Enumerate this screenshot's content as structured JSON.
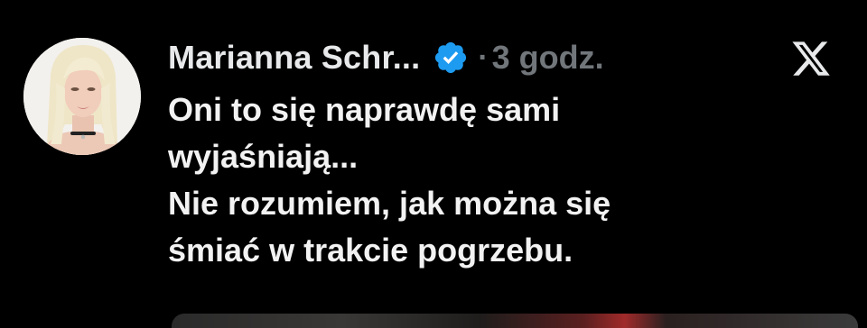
{
  "tweet": {
    "author_name": "Marianna Schr...",
    "separator": "·",
    "time": "3 godz.",
    "verified_icon": "verified-badge-icon",
    "verified_color": "#1d9bf0",
    "platform_icon": "x-logo-icon",
    "text_lines": [
      "Oni to się naprawdę sami",
      "wyjaśniają...",
      "Nie rozumiem, jak można się",
      "śmiać w trakcie pogrzebu."
    ]
  },
  "colors": {
    "background": "#000000",
    "text": "#e7e9ea",
    "muted": "#71767b"
  }
}
